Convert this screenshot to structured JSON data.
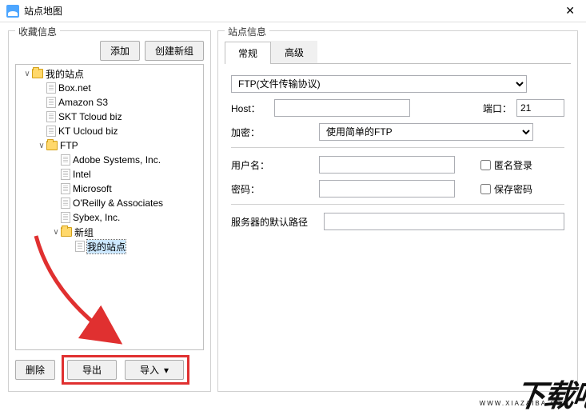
{
  "window": {
    "title": "站点地图",
    "close": "✕"
  },
  "left": {
    "title": "收藏信息",
    "add_btn": "添加",
    "newgroup_btn": "创建新组",
    "delete_btn": "删除",
    "export_btn": "导出",
    "import_btn": "导入",
    "tree": [
      {
        "label": "我的站点",
        "icon": "folder",
        "depth": 0,
        "expander": "∨"
      },
      {
        "label": "Box.net",
        "icon": "file",
        "depth": 1,
        "expander": ""
      },
      {
        "label": "Amazon S3",
        "icon": "file",
        "depth": 1,
        "expander": ""
      },
      {
        "label": "SKT Tcloud biz",
        "icon": "file",
        "depth": 1,
        "expander": ""
      },
      {
        "label": "KT Ucloud biz",
        "icon": "file",
        "depth": 1,
        "expander": ""
      },
      {
        "label": "FTP",
        "icon": "folder",
        "depth": 1,
        "expander": "∨"
      },
      {
        "label": "Adobe Systems, Inc.",
        "icon": "file",
        "depth": 2,
        "expander": ""
      },
      {
        "label": "Intel",
        "icon": "file",
        "depth": 2,
        "expander": ""
      },
      {
        "label": "Microsoft",
        "icon": "file",
        "depth": 2,
        "expander": ""
      },
      {
        "label": "O'Reilly & Associates",
        "icon": "file",
        "depth": 2,
        "expander": ""
      },
      {
        "label": "Sybex, Inc.",
        "icon": "file",
        "depth": 2,
        "expander": ""
      },
      {
        "label": "新组",
        "icon": "folder",
        "depth": 2,
        "expander": "∨"
      },
      {
        "label": "我的站点",
        "icon": "file",
        "depth": 3,
        "expander": "",
        "selected": true
      }
    ]
  },
  "right": {
    "title": "站点信息",
    "tabs": {
      "general": "常规",
      "advanced": "高级"
    },
    "protocol": "FTP(文件传输协议)",
    "host_label": "Host：",
    "host_value": "",
    "port_label": "端口：",
    "port_value": "21",
    "enc_label": "加密：",
    "enc_value": "使用简单的FTP",
    "user_label": "用户名：",
    "user_value": "",
    "anon_label": "匿名登录",
    "pass_label": "密码：",
    "pass_value": "",
    "savepass_label": "保存密码",
    "defpath_label": "服务器的默认路径",
    "defpath_value": ""
  },
  "watermark": {
    "big": "下载吧",
    "small": "WWW.XIAZAIBA.COM"
  }
}
